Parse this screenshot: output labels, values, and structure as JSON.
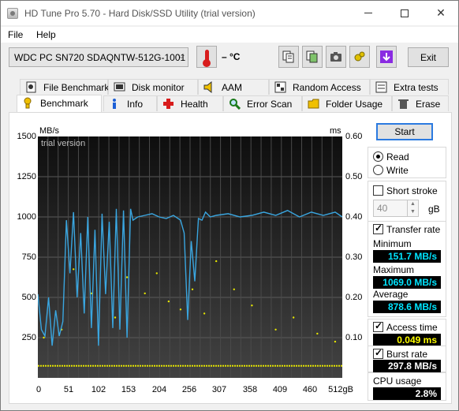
{
  "window": {
    "title": "HD Tune Pro 5.70 - Hard Disk/SSD Utility (trial version)"
  },
  "menu": {
    "file": "File",
    "help": "Help"
  },
  "toolbar": {
    "drive": "WDC PC SN720 SDAQNTW-512G-1001 (",
    "temperature": "– °C",
    "exit_label": "Exit",
    "icons": [
      "copy-text-icon",
      "copy-screenshot-icon",
      "camera-icon",
      "settings-icon",
      "download-icon"
    ]
  },
  "tabs": {
    "row1": [
      "File Benchmark",
      "Disk monitor",
      "AAM",
      "Random Access",
      "Extra tests"
    ],
    "row2": [
      "Benchmark",
      "Info",
      "Health",
      "Error Scan",
      "Folder Usage",
      "Erase"
    ]
  },
  "graph": {
    "left_unit": "MB/s",
    "right_unit": "ms",
    "watermark": "trial version",
    "y_left_ticks": [
      "1500",
      "1250",
      "1000",
      "750",
      "500",
      "250"
    ],
    "y_right_ticks": [
      "0.60",
      "0.50",
      "0.40",
      "0.30",
      "0.20",
      "0.10"
    ],
    "x_ticks": [
      "0",
      "51",
      "102",
      "153",
      "204",
      "256",
      "307",
      "358",
      "409",
      "460",
      "512gB"
    ]
  },
  "controls": {
    "start_label": "Start",
    "read_label": "Read",
    "write_label": "Write",
    "short_stroke_label": "Short stroke",
    "short_stroke_value": "40",
    "short_stroke_unit": "gB",
    "transfer_rate_label": "Transfer rate",
    "access_time_label": "Access time",
    "burst_rate_label": "Burst rate",
    "cpu_usage_label": "CPU usage"
  },
  "stats": {
    "minimum_label": "Minimum",
    "minimum": "151.7 MB/s",
    "maximum_label": "Maximum",
    "maximum": "1069.0 MB/s",
    "average_label": "Average",
    "average": "878.6 MB/s",
    "access_time": "0.049 ms",
    "burst_rate": "297.8 MB/s",
    "cpu_usage": "2.8%"
  },
  "chart_data": {
    "type": "line",
    "x_range": [
      0,
      512
    ],
    "y_left_range": [
      0,
      1500
    ],
    "y_right_range": [
      0,
      0.6
    ],
    "series": [
      {
        "name": "Transfer rate",
        "color": "#3aa6e0",
        "x": [
          0,
          6,
          12,
          18,
          24,
          30,
          36,
          42,
          48,
          54,
          60,
          66,
          72,
          78,
          84,
          90,
          96,
          102,
          108,
          114,
          120,
          126,
          132,
          138,
          144,
          150,
          156,
          160,
          168,
          180,
          192,
          204,
          216,
          228,
          240,
          246,
          252,
          258,
          264,
          270,
          276,
          282,
          290,
          300,
          320,
          340,
          360,
          380,
          400,
          420,
          440,
          460,
          480,
          500,
          512
        ],
        "y": [
          520,
          300,
          260,
          500,
          200,
          420,
          260,
          350,
          980,
          650,
          1030,
          500,
          900,
          400,
          1000,
          310,
          920,
          200,
          1020,
          520,
          970,
          310,
          1050,
          300,
          1040,
          250,
          1050,
          980,
          1000,
          1010,
          1020,
          1000,
          990,
          1010,
          980,
          900,
          360,
          850,
          600,
          990,
          980,
          1030,
          1000,
          1010,
          1020,
          1000,
          1010,
          1030,
          1010,
          1040,
          1000,
          1030,
          1010,
          1030,
          1000
        ]
      },
      {
        "name": "Access time",
        "color": "#e6e600",
        "type": "scatter",
        "baseline_ms": 0.03,
        "points_ms": [
          [
            10,
            0.1
          ],
          [
            40,
            0.12
          ],
          [
            60,
            0.27
          ],
          [
            90,
            0.21
          ],
          [
            130,
            0.15
          ],
          [
            150,
            0.25
          ],
          [
            180,
            0.21
          ],
          [
            200,
            0.26
          ],
          [
            220,
            0.19
          ],
          [
            240,
            0.17
          ],
          [
            260,
            0.22
          ],
          [
            280,
            0.16
          ],
          [
            300,
            0.29
          ],
          [
            330,
            0.22
          ],
          [
            360,
            0.18
          ],
          [
            400,
            0.12
          ],
          [
            430,
            0.15
          ],
          [
            470,
            0.11
          ],
          [
            500,
            0.09
          ]
        ]
      }
    ]
  }
}
